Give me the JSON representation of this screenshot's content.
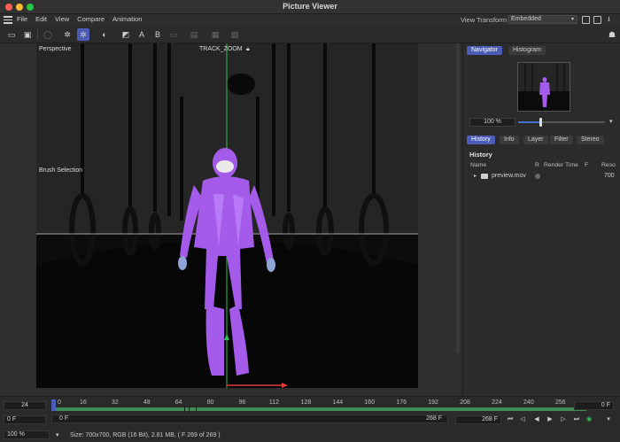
{
  "window": {
    "title": "Picture Viewer"
  },
  "menu": {
    "items": [
      "File",
      "Edit",
      "View",
      "Compare",
      "Animation"
    ]
  },
  "view_transform": {
    "label": "View Transform",
    "value": "Embedded"
  },
  "toolbar": {
    "text_a": "A",
    "text_b": "B"
  },
  "viewport": {
    "camera_label": "Perspective",
    "track_label": "TRACK_ZOOM",
    "brush_label": "Brush Selection"
  },
  "panel": {
    "tabs_top": [
      "Navigator",
      "Histogram"
    ],
    "zoom": "100 %",
    "zoom_fraction": 0.25,
    "tabs_mid": [
      "History",
      "Info",
      "Layer",
      "Filter",
      "Stereo"
    ],
    "history_title": "History",
    "columns": {
      "name": "Name",
      "r": "R",
      "render_time": "Render Time",
      "f": "F",
      "resolution": "Reso"
    },
    "rows": [
      {
        "name": "preview.mov",
        "resolution": "700"
      }
    ]
  },
  "timeline": {
    "fps": "24",
    "ruler_ticks": [
      "0",
      "16",
      "32",
      "48",
      "64",
      "80",
      "96",
      "112",
      "128",
      "144",
      "160",
      "176",
      "192",
      "208",
      "224",
      "240",
      "256"
    ],
    "current_frame": "0 F",
    "start_frame": "0 F",
    "scrub_end": "268 F",
    "end_frame": "268 F",
    "right_frame": "0 F",
    "zoom": "100 %",
    "status": "Size: 700x700, RGB (16 Bit), 2.81 MB,  ( F 269 of 269 )"
  },
  "colors": {
    "accent": "#4a5cb5",
    "track": "#3f8a55",
    "suit": "#a45bea"
  }
}
